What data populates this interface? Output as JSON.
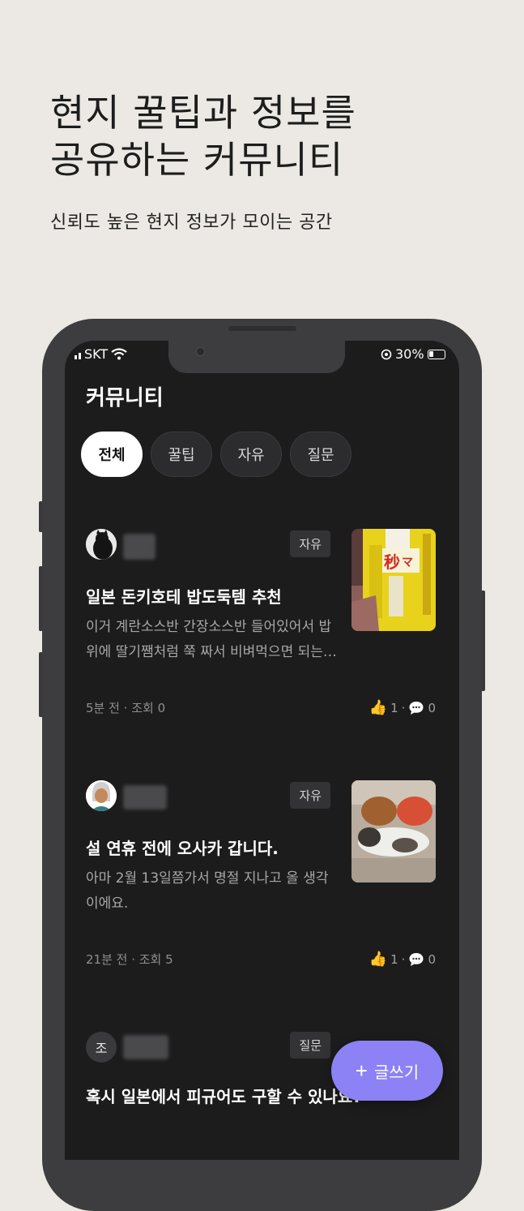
{
  "hero": {
    "title_line1": "현지 꿀팁과 정보를",
    "title_line2": "공유하는 커뮤니티",
    "subtitle": "신뢰도 높은 현지 정보가 모이는 공간"
  },
  "status_bar": {
    "carrier": "SKT",
    "battery": "30%"
  },
  "app": {
    "title": "커뮤니티"
  },
  "tabs": [
    {
      "label": "전체",
      "active": true
    },
    {
      "label": "꿀팁",
      "active": false
    },
    {
      "label": "자유",
      "active": false
    },
    {
      "label": "질문",
      "active": false
    }
  ],
  "posts": [
    {
      "category": "자유",
      "title": "일본 돈키호테 밥도둑템 추천",
      "body_line1": "이거 계란소스반 간장소스반 들어있어서 밥",
      "body_line2": "위에 딸기쨈처럼 쭉 짜서 비벼먹으면 되는…",
      "meta": "5분 전 · 조회 0",
      "likes": "1",
      "comments": "0"
    },
    {
      "category": "자유",
      "title": "설 연휴 전에 오사카 갑니다.",
      "body_line1": "아마 2월 13일쯤가서 명절 지나고 올 생각",
      "body_line2": "이에요.",
      "meta": "21분 전 · 조회 5",
      "likes": "1",
      "comments": "0"
    },
    {
      "category": "질문",
      "avatar_initial": "조",
      "title": "혹시 일본에서 피규어도 구할 수 있나요?"
    }
  ],
  "fab": {
    "label": "글쓰기",
    "icon": "plus-icon"
  },
  "colors": {
    "accent": "#8c82f5",
    "screen_bg": "#1c1c1c",
    "page_bg": "#ece9e4"
  }
}
